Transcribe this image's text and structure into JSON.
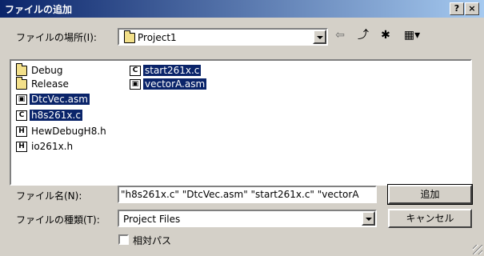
{
  "window": {
    "title": "ファイルの追加",
    "help_label": "?",
    "close_label": "×"
  },
  "location": {
    "label": "ファイルの場所(I):",
    "value": "Project1"
  },
  "toolbar": {
    "back_glyph": "⇦",
    "up_glyph": "⤴",
    "new_folder_glyph": "✱",
    "view_glyph": "▦▾"
  },
  "files": [
    {
      "name": "Debug",
      "type": "folder",
      "selected": false
    },
    {
      "name": "Release",
      "type": "folder",
      "selected": false
    },
    {
      "name": "DtcVec.asm",
      "type": "asm",
      "selected": true
    },
    {
      "name": "h8s261x.c",
      "type": "c",
      "selected": true
    },
    {
      "name": "HewDebugH8.h",
      "type": "h",
      "selected": false
    },
    {
      "name": "io261x.h",
      "type": "h",
      "selected": false
    },
    {
      "name": "start261x.c",
      "type": "c",
      "selected": true
    },
    {
      "name": "vectorA.asm",
      "type": "asm",
      "selected": true
    }
  ],
  "filename": {
    "label": "ファイル名(N):",
    "value": "\"h8s261x.c\" \"DtcVec.asm\" \"start261x.c\" \"vectorA"
  },
  "filetype": {
    "label": "ファイルの種類(T):",
    "value": "Project Files"
  },
  "buttons": {
    "add": "追加",
    "cancel": "キャンセル"
  },
  "relative_path": {
    "label": "相対パス",
    "checked": false
  }
}
